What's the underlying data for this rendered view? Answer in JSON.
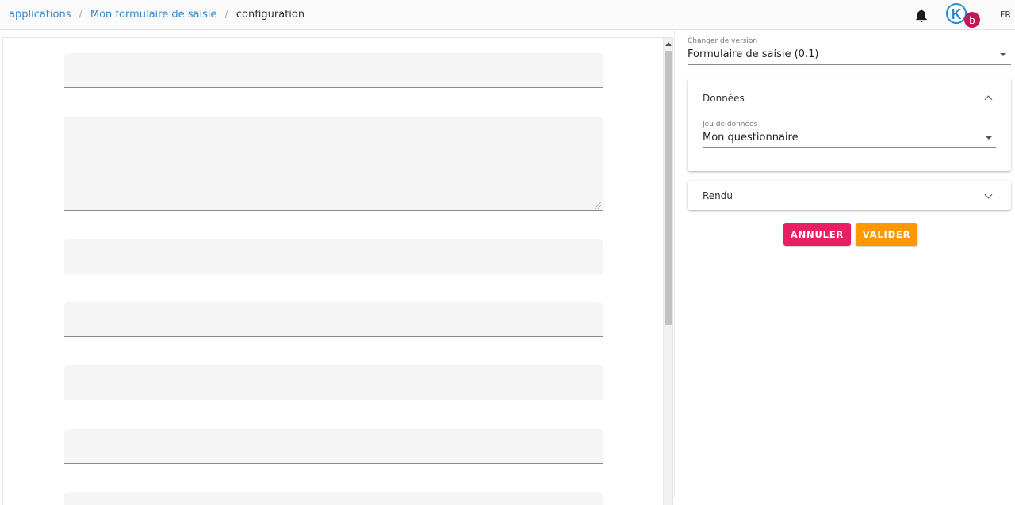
{
  "header": {
    "breadcrumb": [
      {
        "label": "applications"
      },
      {
        "label": "Mon formulaire de saisie"
      },
      {
        "label": "configuration"
      }
    ],
    "separator": "/",
    "notification_icon": "bell-icon",
    "avatar": {
      "logo_letter": "K",
      "badge_letter": "b",
      "logo_color": "#2a8bd1",
      "badge_color": "#c2185b"
    },
    "language": "FR"
  },
  "preview": {
    "fields_icon": "empty-text-field"
  },
  "sidebar": {
    "version": {
      "label": "Changer de version",
      "value": "Formulaire de saisie (0.1)"
    },
    "data_panel": {
      "title": "Données",
      "dataset": {
        "label": "Jeu de données",
        "value": "Mon questionnaire"
      }
    },
    "render_panel": {
      "title": "Rendu"
    },
    "buttons": {
      "cancel": "ANNULER",
      "validate": "VALIDER"
    },
    "colors": {
      "cancel": "#e91e63",
      "validate": "#ff9800",
      "link": "#2a8bd1"
    }
  }
}
